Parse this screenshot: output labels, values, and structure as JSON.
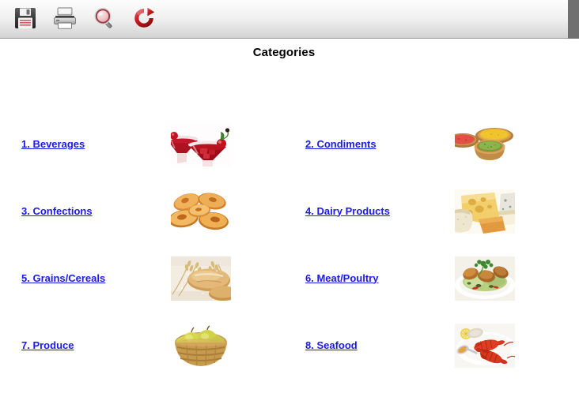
{
  "window": {
    "title": "Categories"
  },
  "toolbar": {
    "buttons": [
      {
        "name": "save-button",
        "icon": "floppy-disk-icon",
        "label": "Save"
      },
      {
        "name": "print-button",
        "icon": "printer-icon",
        "label": "Print"
      },
      {
        "name": "preview-button",
        "icon": "magnifier-icon",
        "label": "Print Preview"
      },
      {
        "name": "refresh-button",
        "icon": "refresh-icon",
        "label": "Refresh"
      }
    ]
  },
  "heading": {
    "text": "Categories"
  },
  "categories": [
    {
      "number": "1.",
      "label": "1. Beverages",
      "name": "beverages",
      "image": "red-cocktail-glasses-with-cherries"
    },
    {
      "number": "2.",
      "label": "2. Condiments",
      "name": "condiments",
      "image": "wooden-bowls-of-red-yellow-green-spices"
    },
    {
      "number": "3.",
      "label": "3. Confections",
      "name": "confections",
      "image": "golden-palmier-pastries"
    },
    {
      "number": "4.",
      "label": "4. Dairy Products",
      "name": "dairy-products",
      "image": "assorted-cheese-wedges"
    },
    {
      "number": "5.",
      "label": "5. Grains/Cereals",
      "name": "grains-cereals",
      "image": "bread-loaves-with-wheat-stalks"
    },
    {
      "number": "6.",
      "label": "6. Meat/Poultry",
      "name": "meat-poultry",
      "image": "roast-chicken-plate-with-herbs"
    },
    {
      "number": "7.",
      "label": "7. Produce",
      "name": "produce",
      "image": "basket-of-pears-and-apples"
    },
    {
      "number": "8.",
      "label": "8. Seafood",
      "name": "seafood",
      "image": "cooked-lobsters-on-plate-with-lemon"
    }
  ],
  "colors": {
    "link": "#1a1aee",
    "heading": "#000000",
    "toolbar_top": "#fdfdfd",
    "toolbar_bottom": "#d2d2d2",
    "toolbar_rail": "#707070",
    "page_background": "#ffffff"
  }
}
